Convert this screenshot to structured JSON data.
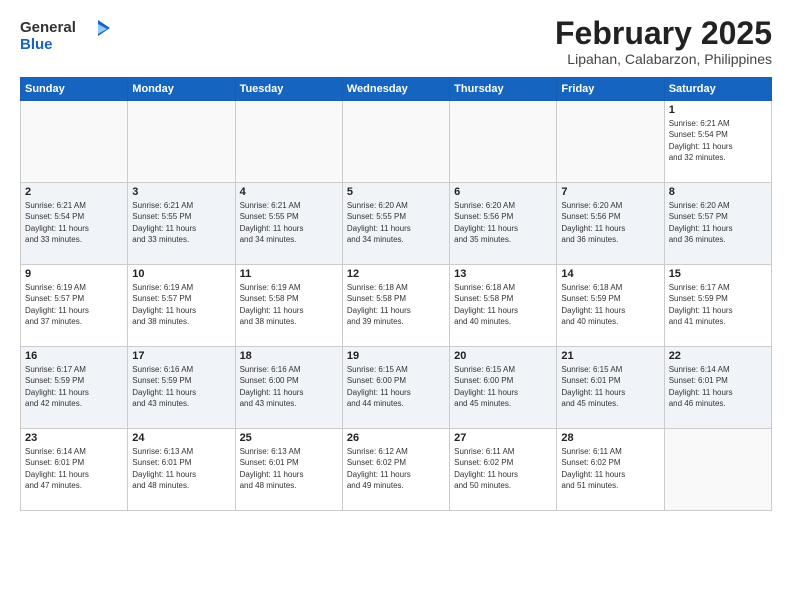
{
  "header": {
    "logo_general": "General",
    "logo_blue": "Blue",
    "month_title": "February 2025",
    "location": "Lipahan, Calabarzon, Philippines"
  },
  "weekdays": [
    "Sunday",
    "Monday",
    "Tuesday",
    "Wednesday",
    "Thursday",
    "Friday",
    "Saturday"
  ],
  "weeks": [
    [
      {
        "day": "",
        "info": ""
      },
      {
        "day": "",
        "info": ""
      },
      {
        "day": "",
        "info": ""
      },
      {
        "day": "",
        "info": ""
      },
      {
        "day": "",
        "info": ""
      },
      {
        "day": "",
        "info": ""
      },
      {
        "day": "1",
        "info": "Sunrise: 6:21 AM\nSunset: 5:54 PM\nDaylight: 11 hours\nand 32 minutes."
      }
    ],
    [
      {
        "day": "2",
        "info": "Sunrise: 6:21 AM\nSunset: 5:54 PM\nDaylight: 11 hours\nand 33 minutes."
      },
      {
        "day": "3",
        "info": "Sunrise: 6:21 AM\nSunset: 5:55 PM\nDaylight: 11 hours\nand 33 minutes."
      },
      {
        "day": "4",
        "info": "Sunrise: 6:21 AM\nSunset: 5:55 PM\nDaylight: 11 hours\nand 34 minutes."
      },
      {
        "day": "5",
        "info": "Sunrise: 6:20 AM\nSunset: 5:55 PM\nDaylight: 11 hours\nand 34 minutes."
      },
      {
        "day": "6",
        "info": "Sunrise: 6:20 AM\nSunset: 5:56 PM\nDaylight: 11 hours\nand 35 minutes."
      },
      {
        "day": "7",
        "info": "Sunrise: 6:20 AM\nSunset: 5:56 PM\nDaylight: 11 hours\nand 36 minutes."
      },
      {
        "day": "8",
        "info": "Sunrise: 6:20 AM\nSunset: 5:57 PM\nDaylight: 11 hours\nand 36 minutes."
      }
    ],
    [
      {
        "day": "9",
        "info": "Sunrise: 6:19 AM\nSunset: 5:57 PM\nDaylight: 11 hours\nand 37 minutes."
      },
      {
        "day": "10",
        "info": "Sunrise: 6:19 AM\nSunset: 5:57 PM\nDaylight: 11 hours\nand 38 minutes."
      },
      {
        "day": "11",
        "info": "Sunrise: 6:19 AM\nSunset: 5:58 PM\nDaylight: 11 hours\nand 38 minutes."
      },
      {
        "day": "12",
        "info": "Sunrise: 6:18 AM\nSunset: 5:58 PM\nDaylight: 11 hours\nand 39 minutes."
      },
      {
        "day": "13",
        "info": "Sunrise: 6:18 AM\nSunset: 5:58 PM\nDaylight: 11 hours\nand 40 minutes."
      },
      {
        "day": "14",
        "info": "Sunrise: 6:18 AM\nSunset: 5:59 PM\nDaylight: 11 hours\nand 40 minutes."
      },
      {
        "day": "15",
        "info": "Sunrise: 6:17 AM\nSunset: 5:59 PM\nDaylight: 11 hours\nand 41 minutes."
      }
    ],
    [
      {
        "day": "16",
        "info": "Sunrise: 6:17 AM\nSunset: 5:59 PM\nDaylight: 11 hours\nand 42 minutes."
      },
      {
        "day": "17",
        "info": "Sunrise: 6:16 AM\nSunset: 5:59 PM\nDaylight: 11 hours\nand 43 minutes."
      },
      {
        "day": "18",
        "info": "Sunrise: 6:16 AM\nSunset: 6:00 PM\nDaylight: 11 hours\nand 43 minutes."
      },
      {
        "day": "19",
        "info": "Sunrise: 6:15 AM\nSunset: 6:00 PM\nDaylight: 11 hours\nand 44 minutes."
      },
      {
        "day": "20",
        "info": "Sunrise: 6:15 AM\nSunset: 6:00 PM\nDaylight: 11 hours\nand 45 minutes."
      },
      {
        "day": "21",
        "info": "Sunrise: 6:15 AM\nSunset: 6:01 PM\nDaylight: 11 hours\nand 45 minutes."
      },
      {
        "day": "22",
        "info": "Sunrise: 6:14 AM\nSunset: 6:01 PM\nDaylight: 11 hours\nand 46 minutes."
      }
    ],
    [
      {
        "day": "23",
        "info": "Sunrise: 6:14 AM\nSunset: 6:01 PM\nDaylight: 11 hours\nand 47 minutes."
      },
      {
        "day": "24",
        "info": "Sunrise: 6:13 AM\nSunset: 6:01 PM\nDaylight: 11 hours\nand 48 minutes."
      },
      {
        "day": "25",
        "info": "Sunrise: 6:13 AM\nSunset: 6:01 PM\nDaylight: 11 hours\nand 48 minutes."
      },
      {
        "day": "26",
        "info": "Sunrise: 6:12 AM\nSunset: 6:02 PM\nDaylight: 11 hours\nand 49 minutes."
      },
      {
        "day": "27",
        "info": "Sunrise: 6:11 AM\nSunset: 6:02 PM\nDaylight: 11 hours\nand 50 minutes."
      },
      {
        "day": "28",
        "info": "Sunrise: 6:11 AM\nSunset: 6:02 PM\nDaylight: 11 hours\nand 51 minutes."
      },
      {
        "day": "",
        "info": ""
      }
    ]
  ]
}
